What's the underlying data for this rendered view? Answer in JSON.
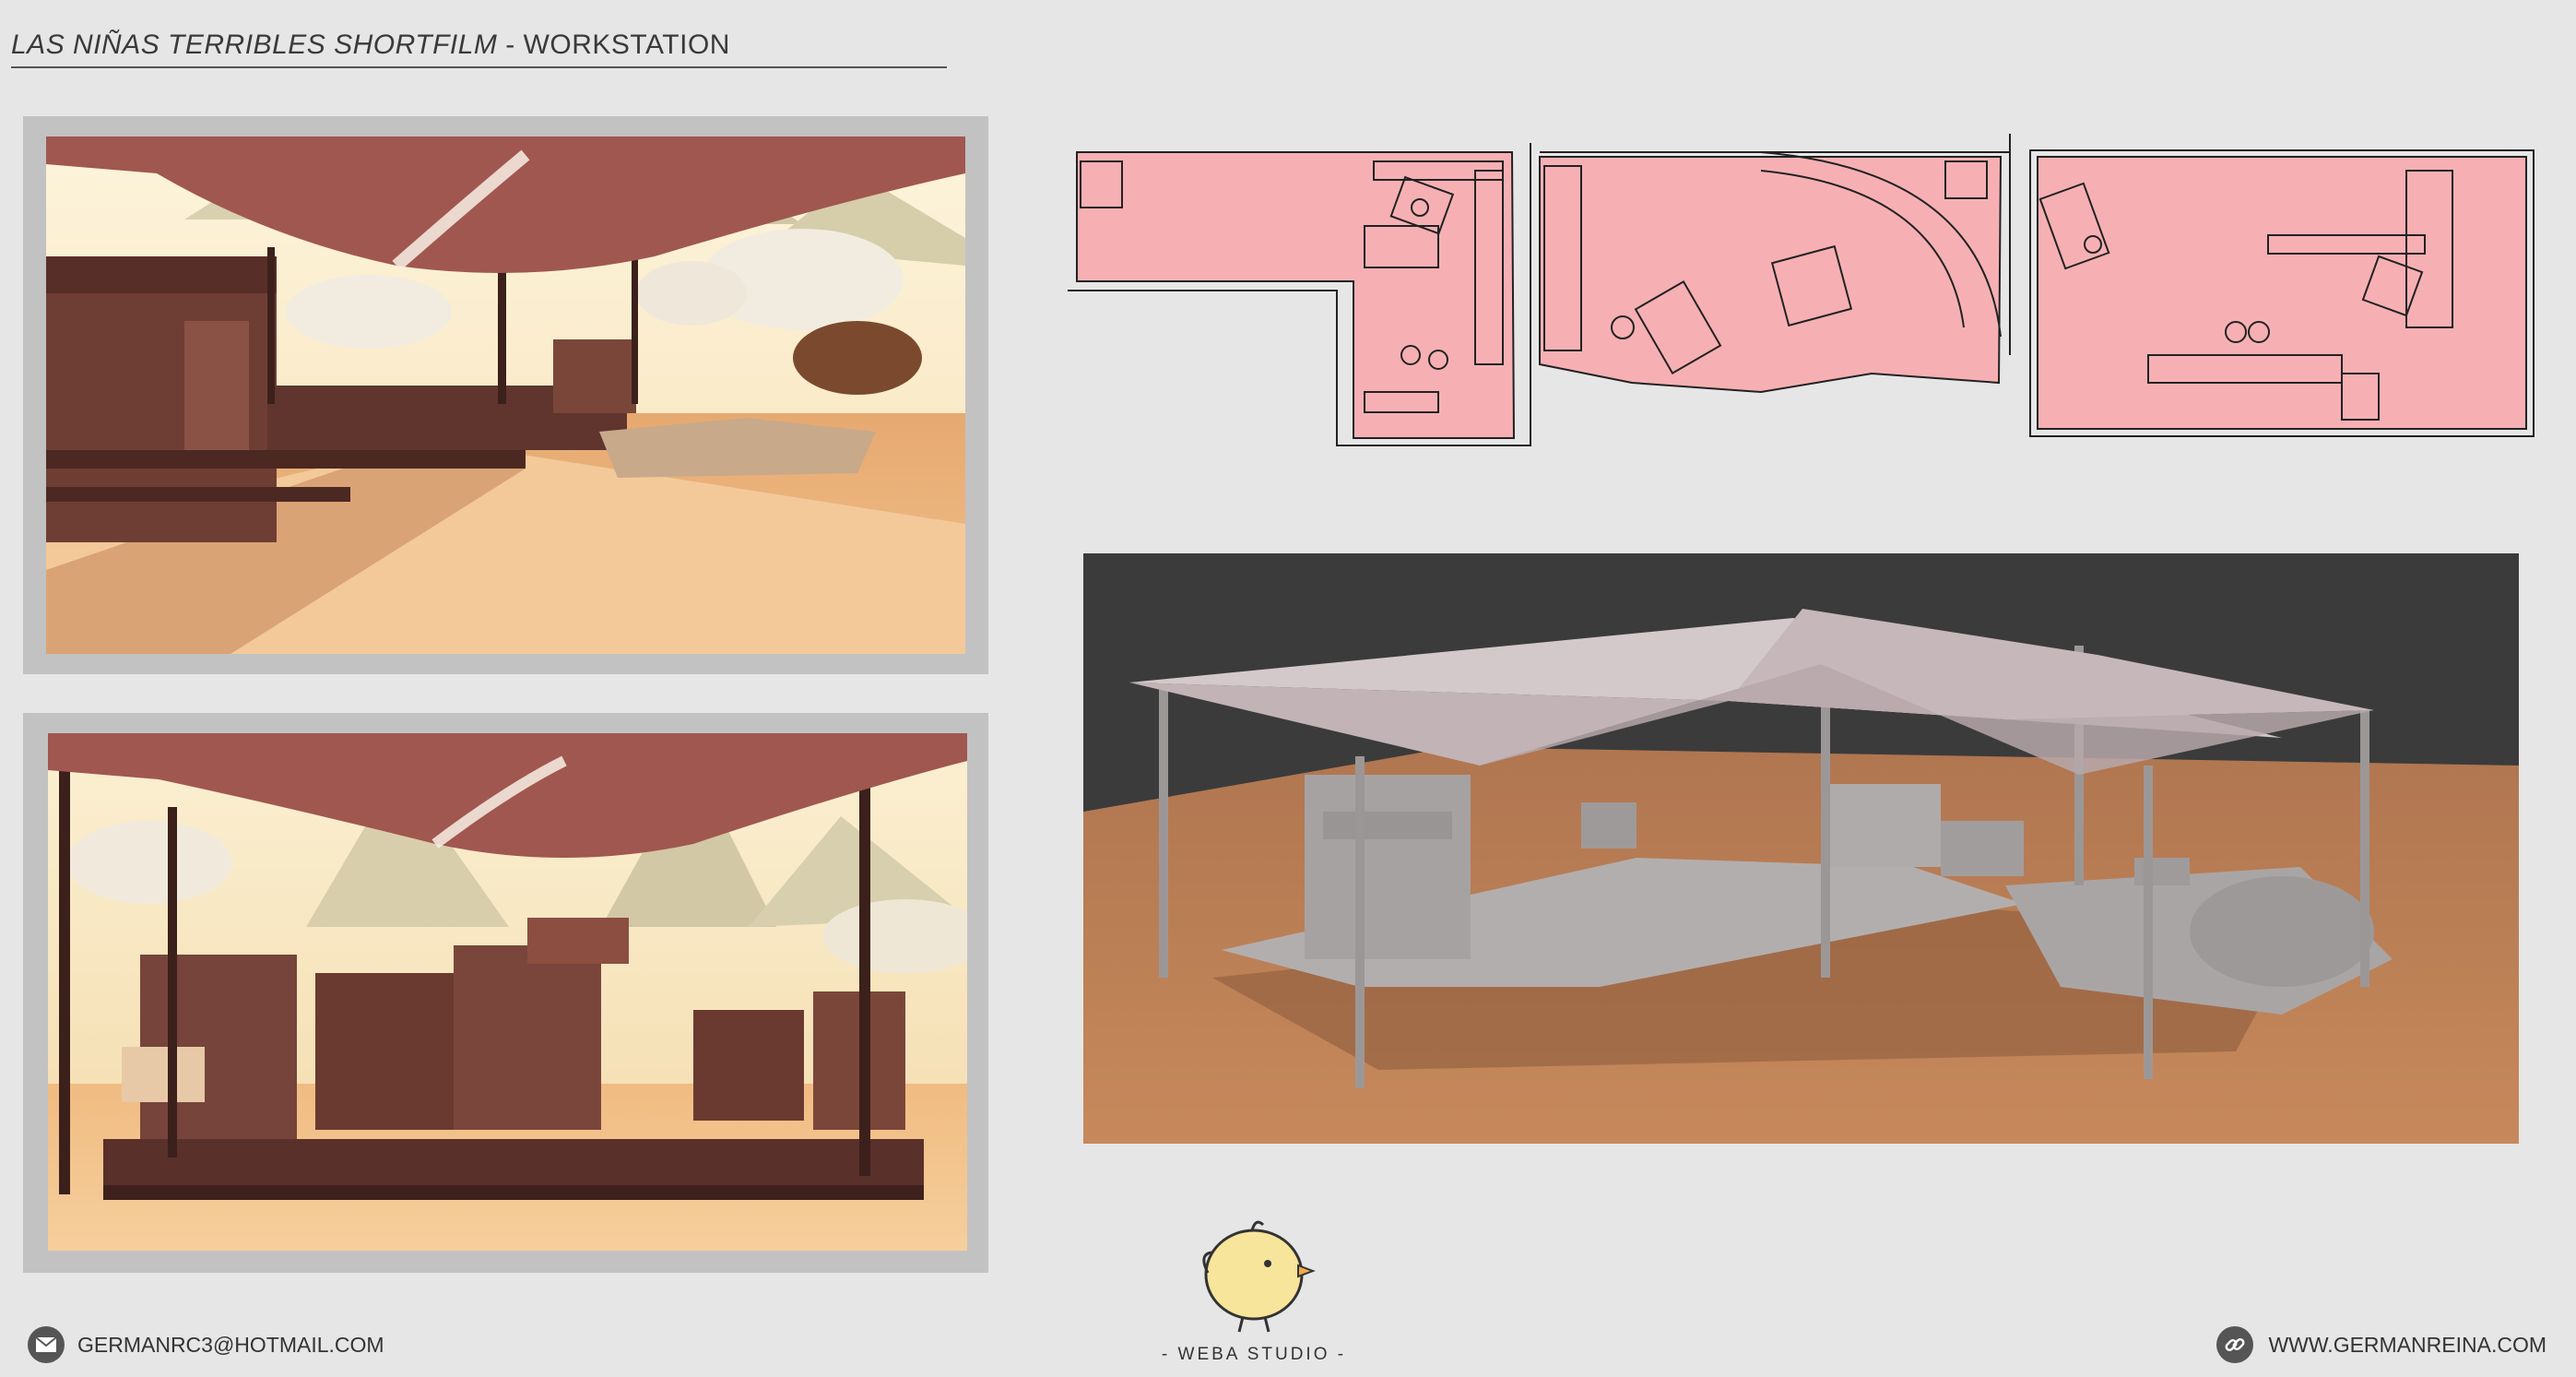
{
  "header": {
    "title_main": "LAS NIÑAS TERRIBLES SHORTFILM",
    "title_sep": " - ",
    "title_sub": "WORKSTATION"
  },
  "panels": {
    "concept_top": {
      "icon": "concept-painting-tent-top"
    },
    "concept_bottom": {
      "icon": "concept-painting-tent-bottom"
    },
    "floorplans": {
      "icon": "floorplan-sketches"
    },
    "render_3d": {
      "icon": "3d-blockout-render"
    }
  },
  "logo": {
    "text": "- WEBA STUDIO -",
    "icon": "chick-mascot"
  },
  "footer": {
    "email": "GERMANRC3@HOTMAIL.COM",
    "email_icon": "envelope-icon",
    "website": "WWW.GERMANREINA.COM",
    "website_icon": "link-icon"
  },
  "colors": {
    "background": "#e6e6e6",
    "frame": "#c2c2c2",
    "sketch_pink": "#f6b0b4",
    "tent": "#a0574f",
    "sand": "#e8b07a",
    "render_bg": "#3a3a3a",
    "render_floor": "#b97a4c"
  }
}
